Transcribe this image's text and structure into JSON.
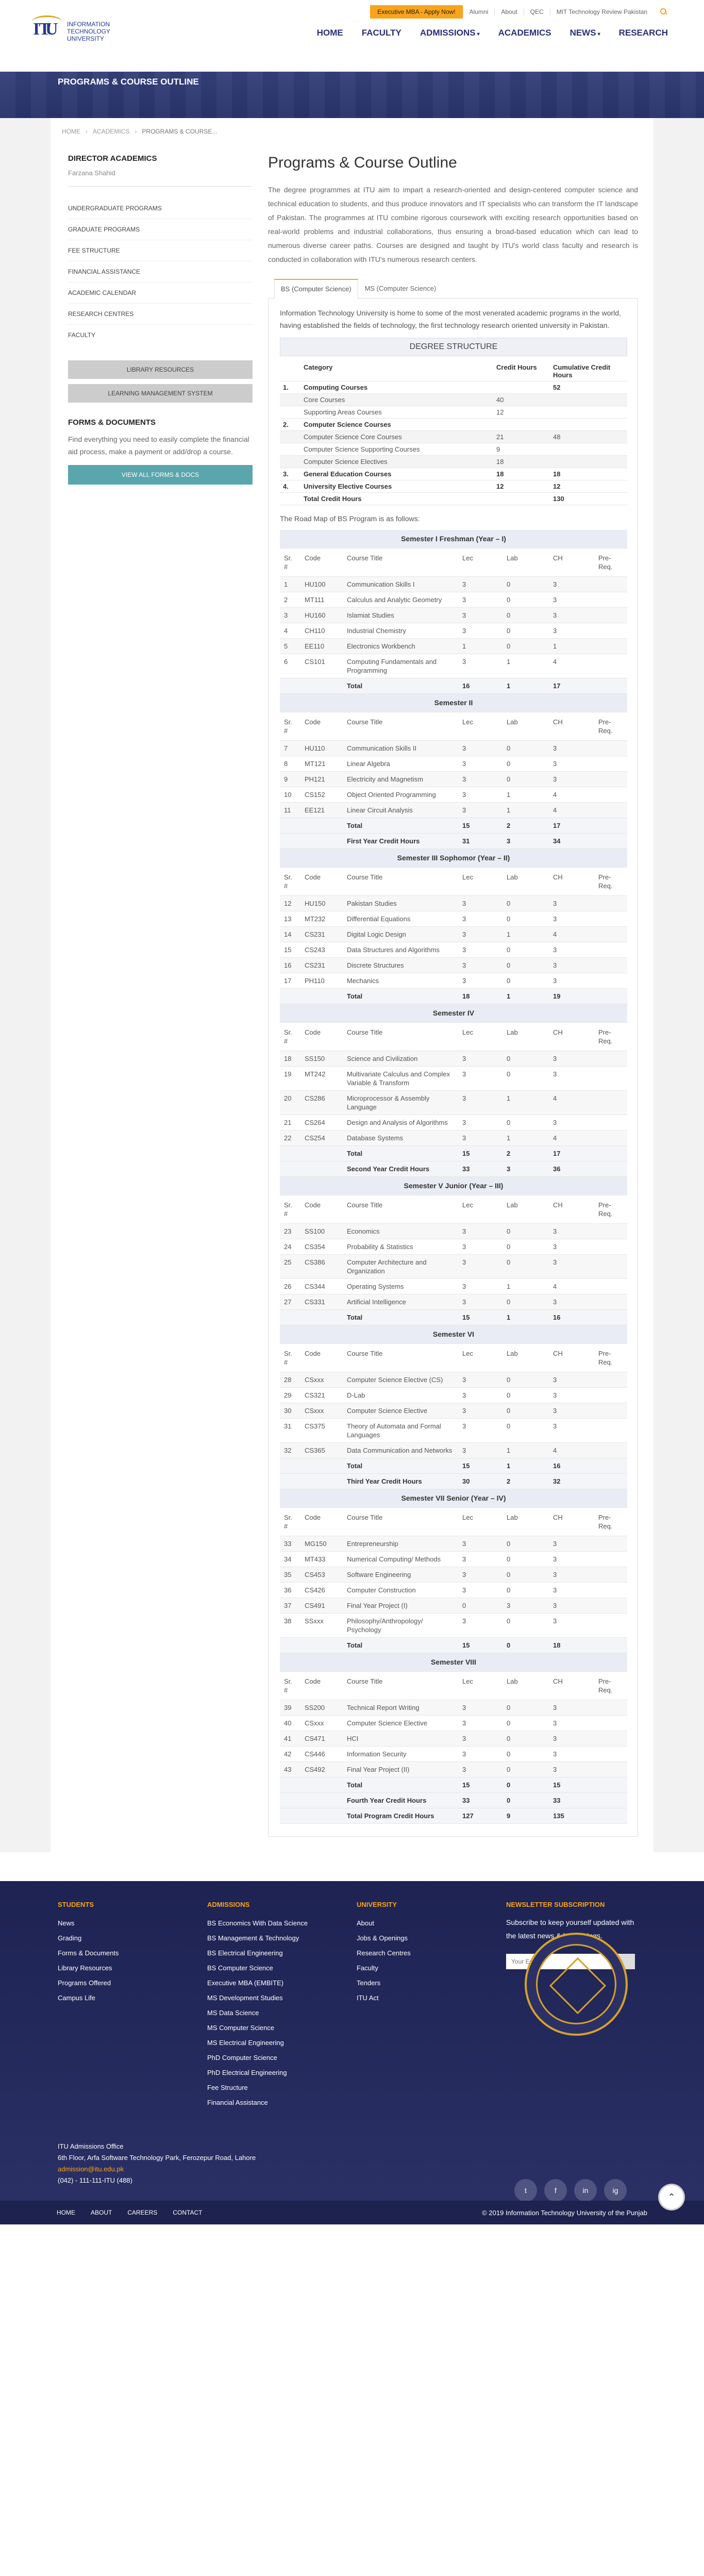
{
  "header": {
    "logo_text": "Information Technology University",
    "utility": {
      "cta": "Executive MBA - Apply Now!",
      "links": [
        "Alumni",
        "About",
        "QEC",
        "MIT Technology Review Pakistan"
      ]
    },
    "nav": [
      "HOME",
      "FACULTY",
      "ADMISSIONS",
      "ACADEMICS",
      "NEWS",
      "RESEARCH"
    ]
  },
  "hero": {
    "title": "PROGRAMS & COURSE OUTLINE"
  },
  "breadcrumb": [
    "HOME",
    "ACADEMICS",
    "PROGRAMS & COURSE..."
  ],
  "sidebar": {
    "title": "DIRECTOR ACADEMICS",
    "person": "Farzana Shahid",
    "links": [
      "UNDERGRADUATE PROGRAMS",
      "GRADUATE PROGRAMS",
      "FEE STRUCTURE",
      "FINANCIAL ASSISTANCE",
      "ACADEMIC CALENDAR",
      "RESEARCH CENTRES",
      "FACULTY"
    ],
    "btn1": "LIBRARY RESOURCES",
    "btn2": "LEARNING MANAGEMENT SYSTEM",
    "forms_title": "FORMS & DOCUMENTS",
    "forms_text": "Find everything you need to easily complete the financial aid process, make a payment or add/drop a course.",
    "forms_btn": "VIEW ALL FORMS & DOCS"
  },
  "main": {
    "title": "Programs & Course Outline",
    "intro": "The degree programmes at ITU aim to impart a research-oriented and design-centered computer science and technical education to students, and thus produce innovators and IT specialists who can transform the IT landscape of Pakistan. The programmes at ITU combine rigorous coursework with exciting research opportunities based on real-world problems and industrial collaborations, thus ensuring a broad-based education which can lead to numerous diverse career paths. Courses are designed and taught by ITU's world class faculty and research is conducted in collaboration with ITU's numerous research centers.",
    "tabs": [
      "BS (Computer Science)",
      "MS (Computer Science)"
    ],
    "panel_intro": "Information Technology University is home to some of the most venerated academic programs in the world, having established the fields of technology, the first technology research oriented university in Pakistan.",
    "degree_heading": "DEGREE STRUCTURE",
    "ds_headers": [
      "",
      "Category",
      "Credit Hours",
      "Cumulative Credit Hours"
    ],
    "ds_rows": [
      {
        "n": "1.",
        "cat": "Computing Courses",
        "ch": "",
        "cum": "52",
        "type": "cat"
      },
      {
        "n": "",
        "cat": "Core Courses",
        "ch": "40",
        "cum": "",
        "type": "shade"
      },
      {
        "n": "",
        "cat": "Supporting Areas Courses",
        "ch": "12",
        "cum": "",
        "type": ""
      },
      {
        "n": "2.",
        "cat": "Computer Science Courses",
        "ch": "",
        "cum": "",
        "type": "cat"
      },
      {
        "n": "",
        "cat": "Computer Science Core Courses",
        "ch": "21",
        "cum": "48",
        "type": "shade"
      },
      {
        "n": "",
        "cat": "Computer Science Supporting Courses",
        "ch": "9",
        "cum": "",
        "type": ""
      },
      {
        "n": "",
        "cat": "Computer Science Electives",
        "ch": "18",
        "cum": "",
        "type": "shade"
      },
      {
        "n": "3.",
        "cat": "General Education Courses",
        "ch": "18",
        "cum": "18",
        "type": "cat"
      },
      {
        "n": "4.",
        "cat": "University Elective Courses",
        "ch": "12",
        "cum": "12",
        "type": "cat"
      },
      {
        "n": "",
        "cat": "Total Credit Hours",
        "ch": "",
        "cum": "130",
        "type": "total"
      }
    ],
    "roadmap_text": "The Road Map of BS Program is as follows:",
    "col_headers": [
      "Sr. #",
      "Code",
      "Course Title",
      "Lec",
      "Lab",
      "CH",
      "Pre-Req."
    ],
    "semesters": [
      {
        "title": "Semester I Freshman (Year – I)",
        "rows": [
          [
            "1",
            "HU100",
            "Communication Skills I",
            "3",
            "0",
            "3",
            ""
          ],
          [
            "2",
            "MT111",
            "Calculus and Analytic Geometry",
            "3",
            "0",
            "3",
            ""
          ],
          [
            "3",
            "HU160",
            "Islamiat Studies",
            "3",
            "0",
            "3",
            ""
          ],
          [
            "4",
            "CH110",
            "Industrial Chemistry",
            "3",
            "0",
            "3",
            ""
          ],
          [
            "5",
            "EE110",
            "Electronics Workbench",
            "1",
            "0",
            "1",
            ""
          ],
          [
            "6",
            "CS101",
            "Computing Fundamentals and Programming",
            "3",
            "1",
            "4",
            ""
          ]
        ],
        "totals": [
          [
            "Total",
            "16",
            "1",
            "17"
          ]
        ]
      },
      {
        "title": "Semester II",
        "rows": [
          [
            "7",
            "HU110",
            "Communication Skills II",
            "3",
            "0",
            "3",
            ""
          ],
          [
            "8",
            "MT121",
            "Linear Algebra",
            "3",
            "0",
            "3",
            ""
          ],
          [
            "9",
            "PH121",
            "Electricity and Magnetism",
            "3",
            "0",
            "3",
            ""
          ],
          [
            "10",
            "CS152",
            "Object Oriented Programming",
            "3",
            "1",
            "4",
            ""
          ],
          [
            "11",
            "EE121",
            "Linear Circuit Analysis",
            "3",
            "1",
            "4",
            ""
          ]
        ],
        "totals": [
          [
            "Total",
            "15",
            "2",
            "17"
          ],
          [
            "First Year Credit Hours",
            "31",
            "3",
            "34"
          ]
        ]
      },
      {
        "title": "Semester III Sophomor (Year – II)",
        "rows": [
          [
            "12",
            "HU150",
            "Pakistan Studies",
            "3",
            "0",
            "3",
            ""
          ],
          [
            "13",
            "MT232",
            "Differential Equations",
            "3",
            "0",
            "3",
            ""
          ],
          [
            "14",
            "CS231",
            "Digital Logic Design",
            "3",
            "1",
            "4",
            ""
          ],
          [
            "15",
            "CS243",
            "Data Structures and Algorithms",
            "3",
            "0",
            "3",
            ""
          ],
          [
            "16",
            "CS231",
            "Discrete Structures",
            "3",
            "0",
            "3",
            ""
          ],
          [
            "17",
            "PH110",
            "Mechanics",
            "3",
            "0",
            "3",
            ""
          ]
        ],
        "totals": [
          [
            "Total",
            "18",
            "1",
            "19"
          ]
        ]
      },
      {
        "title": "Semester IV",
        "rows": [
          [
            "18",
            "SS150",
            "Science and Civilization",
            "3",
            "0",
            "3",
            ""
          ],
          [
            "19",
            "MT242",
            "Multivariate Calculus and Complex Variable & Transform",
            "3",
            "0",
            "3",
            ""
          ],
          [
            "20",
            "CS286",
            "Microprocessor & Assembly Language",
            "3",
            "1",
            "4",
            ""
          ],
          [
            "21",
            "CS264",
            "Design and Analysis of Algorithms",
            "3",
            "0",
            "3",
            ""
          ],
          [
            "22",
            "CS254",
            "Database Systems",
            "3",
            "1",
            "4",
            ""
          ]
        ],
        "totals": [
          [
            "Total",
            "15",
            "2",
            "17"
          ],
          [
            "Second Year Credit Hours",
            "33",
            "3",
            "36"
          ]
        ]
      },
      {
        "title": "Semester V Junior (Year – III)",
        "rows": [
          [
            "23",
            "SS100",
            "Economics",
            "3",
            "0",
            "3",
            ""
          ],
          [
            "24",
            "CS354",
            "Probability & Statistics",
            "3",
            "0",
            "3",
            ""
          ],
          [
            "25",
            "CS386",
            "Computer Architecture and Organization",
            "3",
            "0",
            "3",
            ""
          ],
          [
            "26",
            "CS344",
            "Operating Systems",
            "3",
            "1",
            "4",
            ""
          ],
          [
            "27",
            "CS331",
            "Artificial Intelligence",
            "3",
            "0",
            "3",
            ""
          ]
        ],
        "totals": [
          [
            "Total",
            "15",
            "1",
            "16"
          ]
        ]
      },
      {
        "title": "Semester VI",
        "rows": [
          [
            "28",
            "CSxxx",
            "Computer Science Elective (CS)",
            "3",
            "0",
            "3",
            ""
          ],
          [
            "29",
            "CS321",
            "D-Lab",
            "3",
            "0",
            "3",
            ""
          ],
          [
            "30",
            "CSxxx",
            "Computer Science Elective",
            "3",
            "0",
            "3",
            ""
          ],
          [
            "31",
            "CS375",
            "Theory of Automata and Formal Languages",
            "3",
            "0",
            "3",
            ""
          ],
          [
            "32",
            "CS365",
            "Data Communication and Networks",
            "3",
            "1",
            "4",
            ""
          ]
        ],
        "totals": [
          [
            "Total",
            "15",
            "1",
            "16"
          ],
          [
            "Third Year Credit Hours",
            "30",
            "2",
            "32"
          ]
        ]
      },
      {
        "title": "Semester VII Senior (Year – IV)",
        "rows": [
          [
            "33",
            "MG150",
            "Entrepreneurship",
            "3",
            "0",
            "3",
            ""
          ],
          [
            "34",
            "MT433",
            "Numerical Computing/ Methods",
            "3",
            "0",
            "3",
            ""
          ],
          [
            "35",
            "CS453",
            "Software Engineering",
            "3",
            "0",
            "3",
            ""
          ],
          [
            "36",
            "CS426",
            "Computer Construction",
            "3",
            "0",
            "3",
            ""
          ],
          [
            "37",
            "CS491",
            "Final Year Project (I)",
            "0",
            "3",
            "3",
            ""
          ],
          [
            "38",
            "SSxxx",
            "Philosophy/Anthropology/ Psychology",
            "3",
            "0",
            "3",
            ""
          ]
        ],
        "totals": [
          [
            "Total",
            "15",
            "0",
            "18"
          ]
        ]
      },
      {
        "title": "Semester VIII",
        "rows": [
          [
            "39",
            "SS200",
            "Technical Report Writing",
            "3",
            "0",
            "3",
            ""
          ],
          [
            "40",
            "CSxxx",
            "Computer Science Elective",
            "3",
            "0",
            "3",
            ""
          ],
          [
            "41",
            "CS471",
            "HCI",
            "3",
            "0",
            "3",
            ""
          ],
          [
            "42",
            "CS446",
            "Information Security",
            "3",
            "0",
            "3",
            ""
          ],
          [
            "43",
            "CS492",
            "Final Year Project (II)",
            "3",
            "0",
            "3",
            ""
          ]
        ],
        "totals": [
          [
            "Total",
            "15",
            "0",
            "15"
          ],
          [
            "Fourth Year Credit Hours",
            "33",
            "0",
            "33"
          ],
          [
            "Total Program Credit Hours",
            "127",
            "9",
            "135"
          ]
        ]
      }
    ]
  },
  "footer": {
    "students_title": "STUDENTS",
    "students": [
      "News",
      "Grading",
      "Forms & Documents",
      "Library Resources",
      "Programs Offered",
      "Campus Life"
    ],
    "admissions_title": "ADMISSIONS",
    "admissions": [
      "BS Economics With Data Science",
      "BS Management & Technology",
      "BS Electrical Engineering",
      "BS Computer Science",
      "Executive MBA (EMBITE)",
      "MS Development Studies",
      "MS Data Science",
      "MS Computer Science",
      "MS Electrical Engineering",
      "PhD Computer Science",
      "PhD Electrical Engineering",
      "Fee Structure",
      "Financial Assistance"
    ],
    "university_title": "UNIVERSITY",
    "university": [
      "About",
      "Jobs & Openings",
      "Research Centres",
      "Faculty",
      "Tenders",
      "ITU Act"
    ],
    "newsletter_title": "NEWSLETTER SUBSCRIPTION",
    "newsletter_text": "Subscribe to keep yourself updated with the latest news & happenings.",
    "newsletter_placeholder": "Your Email",
    "address_title": "ITU Admissions Office",
    "address_line": "6th Floor, Arfa Software Technology Park, Ferozepur Road, Lahore",
    "email": "admission@itu.edu.pk",
    "phone": "(042) - 111-111-ITU (488)",
    "social": [
      "t",
      "f",
      "in",
      "ig"
    ],
    "bottom_links": [
      "HOME",
      "ABOUT",
      "CAREERS",
      "CONTACT"
    ],
    "copyright": "© 2019 Information Technology University of the Punjab"
  }
}
